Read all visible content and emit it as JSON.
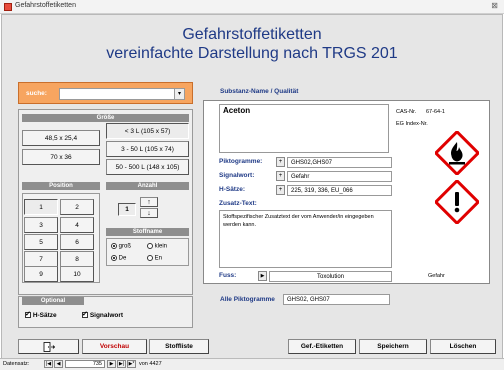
{
  "window": {
    "title": "Gefahrstoffetiketten"
  },
  "header": {
    "line1": "Gefahrstoffetiketten",
    "line2": "vereinfachte Darstellung nach TRGS 201"
  },
  "search": {
    "label": "suche:",
    "value": ""
  },
  "groesse": {
    "title": "Größe",
    "left_buttons": [
      "48,5 x 25,4",
      "70 x 36"
    ],
    "right_buttons": [
      "< 3 L (105 x 57)",
      "3 - 50 L (105 x 74)",
      "50 - 500 L (148 x 105)"
    ]
  },
  "position": {
    "title": "Position",
    "cells": [
      "1",
      "2",
      "3",
      "4",
      "5",
      "6",
      "7",
      "8",
      "9",
      "10"
    ]
  },
  "anzahl": {
    "title": "Anzahl",
    "value": "1"
  },
  "stoffname": {
    "title": "Stoffname",
    "opt_gross": "groß",
    "opt_klein": "klein",
    "opt_de": "De",
    "opt_en": "En"
  },
  "optional": {
    "title": "Optional",
    "hsaetze": "H-Sätze",
    "signalwort": "Signalwort"
  },
  "substanz": {
    "section_label": "Substanz-Name / Qualität",
    "name": "Aceton",
    "cas_label": "CAS-Nr.",
    "cas_value": "67-64-1",
    "eg_label": "EG Index-Nr.",
    "piktogramme_label": "Piktogramme:",
    "piktogramme_value": "GHS02,GHS07",
    "signalwort_label": "Signalwort:",
    "signalwort_value": "Gefahr",
    "hsaetze_label": "H-Sätze:",
    "hsaetze_value": "225, 319, 336, EU_066",
    "zusatz_label": "Zusatz-Text:",
    "zusatz_value": "Stoffspezifischer Zusatztext der vom Anwender/in eingegeben werden kann.",
    "fuss_label": "Fuss:",
    "fuss_value": "Toxolution",
    "fuss_right": "Gefahr",
    "alle_label": "Alle Piktogramme",
    "alle_value": "GHS02, GHS07"
  },
  "buttons": {
    "vorschau": "Vorschau",
    "stoffliste": "Stoffliste",
    "gef_etiketten": "Gef.-Etiketten",
    "speichern": "Speichern",
    "loeschen": "Löschen"
  },
  "nav": {
    "label": "Datensatz:",
    "current": "735",
    "total": "von 4427"
  },
  "colors": {
    "title_blue": "#1f3a86",
    "orange": "#f7a560",
    "vorschau_red": "#c00000",
    "ghs_red": "#e00000"
  },
  "icons": [
    "flame-pictogram",
    "exclamation-pictogram",
    "exit-door-icon",
    "dropdown-arrow-icon",
    "arrow-up-icon",
    "arrow-down-icon"
  ]
}
